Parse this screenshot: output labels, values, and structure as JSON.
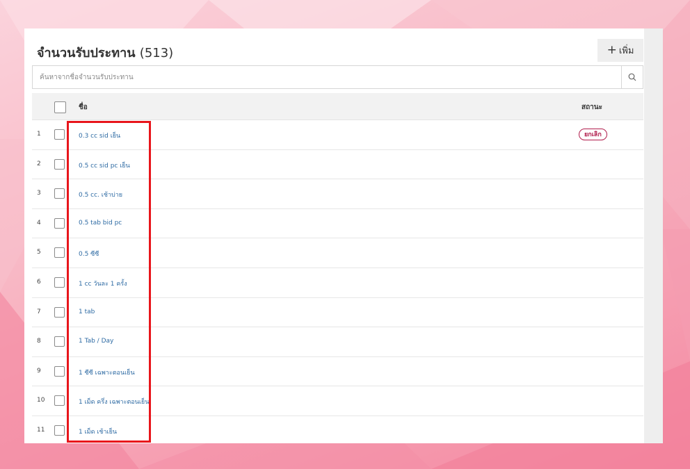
{
  "header": {
    "title": "จำนวนรับประทาน",
    "count": "(513)",
    "add_label": "เพิ่ม",
    "add_symbol": "+"
  },
  "search": {
    "placeholder": "ค้นหาจากชื่อจำนวนรับประทาน",
    "icon": "search-icon"
  },
  "table": {
    "columns": {
      "name": "ชื่อ",
      "status": "สถานะ"
    },
    "rows": [
      {
        "num": "1",
        "name": "0.3 cc sid เย็น",
        "status": "ยกเลิก"
      },
      {
        "num": "2",
        "name": "0.5 cc sid pc เย็น",
        "status": ""
      },
      {
        "num": "3",
        "name": "0.5 cc. เช้าบ่าย",
        "status": ""
      },
      {
        "num": "4",
        "name": "0.5 tab bid pc",
        "status": ""
      },
      {
        "num": "5",
        "name": "0.5 ซีซี",
        "status": ""
      },
      {
        "num": "6",
        "name": "1 cc วันละ 1 ครั้ง",
        "status": ""
      },
      {
        "num": "7",
        "name": "1 tab",
        "status": ""
      },
      {
        "num": "8",
        "name": "1 Tab / Day",
        "status": ""
      },
      {
        "num": "9",
        "name": "1 ซีซี เฉพาะตอนเย็น",
        "status": ""
      },
      {
        "num": "10",
        "name": "1 เม็ด ครึ่ง เฉพาะตอนเย็น",
        "status": ""
      },
      {
        "num": "11",
        "name": "1 เม็ด เช้าเย็น",
        "status": ""
      }
    ]
  },
  "colors": {
    "link": "#2d6aa3",
    "badge": "#b01c4b",
    "highlight": "#e8151b"
  }
}
